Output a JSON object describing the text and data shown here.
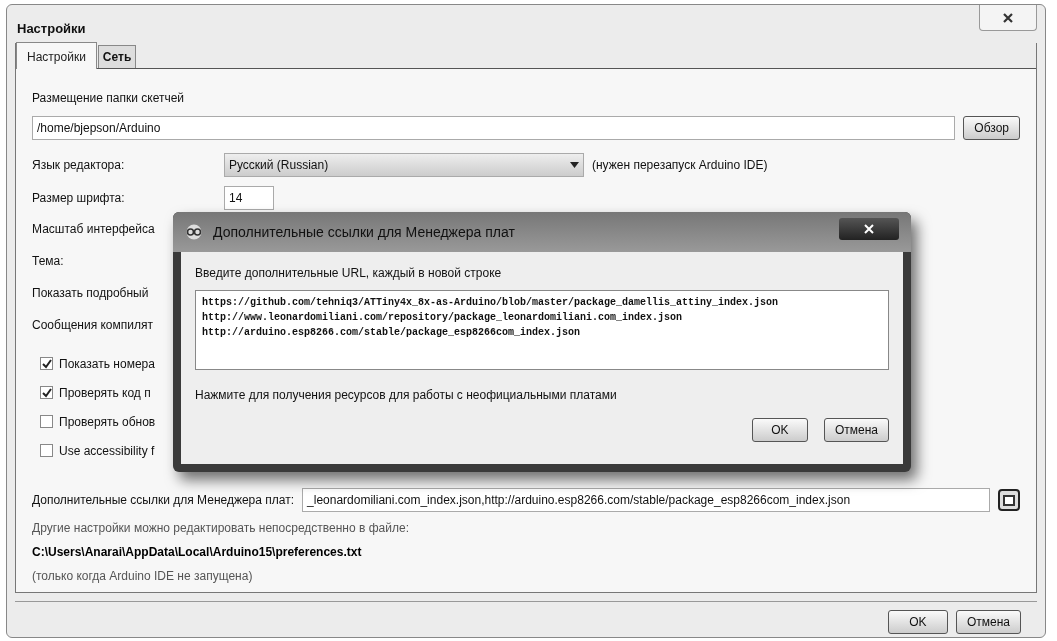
{
  "window": {
    "title": "Настройки"
  },
  "tabs": [
    {
      "label": "Настройки",
      "selected": true
    },
    {
      "label": "Сеть",
      "selected": false
    }
  ],
  "sketchbook": {
    "label": "Размещение папки скетчей",
    "value": "/home/bjepson/Arduino",
    "button": "Обзор"
  },
  "language": {
    "label": "Язык редактора:",
    "value": "Русский (Russian)",
    "note": "(нужен перезапуск Arduino IDE)"
  },
  "font_size": {
    "label": "Размер шрифта:",
    "value": "14"
  },
  "rows": [
    {
      "label": "Масштаб интерфейса"
    },
    {
      "label": "Тема:"
    },
    {
      "label": "Показать подробный"
    },
    {
      "label": "Сообщения компилят"
    }
  ],
  "checkboxes": [
    {
      "label": "Показать номера",
      "checked": true
    },
    {
      "label": "Проверять код п",
      "checked": true
    },
    {
      "label": "Проверять обнов",
      "checked": false
    },
    {
      "label": "Use accessibility f",
      "checked": false
    }
  ],
  "board_urls": {
    "label": "Дополнительные ссылки для Менеджера плат:",
    "value": "_leonardomiliani.com_index.json,http://arduino.esp8266.com/stable/package_esp8266com_index.json"
  },
  "notes": [
    {
      "kind": "muted",
      "text": "Другие настройки можно редактировать непосредственно в файле:"
    },
    {
      "kind": "path",
      "text": "C:\\Users\\Anarai\\AppData\\Local\\Arduino15\\preferences.txt"
    },
    {
      "kind": "muted",
      "text": "(только когда Arduino IDE не запущена)"
    }
  ],
  "buttons": [
    {
      "label": "OK"
    },
    {
      "label": "Отмена"
    }
  ],
  "dialog": {
    "title": "Дополнительные ссылки для Менеджера плат",
    "prompt": "Введите дополнительные URL, каждый в новой строке",
    "lines": [
      "https://github.com/tehniq3/ATTiny4x_8x-as-Arduino/blob/master/package_damellis_attiny_index.json",
      "http://www.leonardomiliani.com/repository/package_leonardomiliani.com_index.json",
      "http://arduino.esp8266.com/stable/package_esp8266com_index.json"
    ],
    "link": "Нажмите для получения ресурсов для работы с неофициальными платами",
    "buttons": [
      {
        "label": "OK"
      },
      {
        "label": "Отмена"
      }
    ]
  }
}
